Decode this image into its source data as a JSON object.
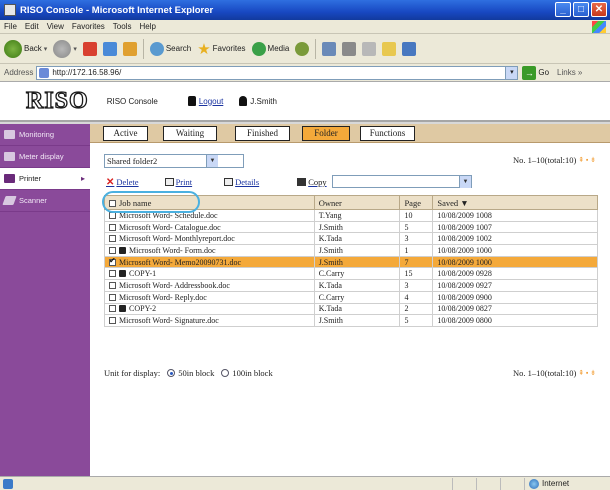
{
  "window": {
    "title": "RISO Console - Microsoft Internet Explorer",
    "controls": [
      "_",
      "□",
      "✕"
    ]
  },
  "menu": [
    "File",
    "Edit",
    "View",
    "Favorites",
    "Tools",
    "Help"
  ],
  "toolbar": {
    "back": "Back",
    "search": "Search",
    "favorites": "Favorites",
    "media": "Media"
  },
  "address": {
    "label": "Address",
    "url": "http://172.16.58.96/",
    "go": "Go",
    "links": "Links »"
  },
  "header": {
    "logo": "RISO",
    "console": "RISO Console",
    "logout": "Logout",
    "user": "J.Smith"
  },
  "sidebar": {
    "items": [
      {
        "label": "Monitoring"
      },
      {
        "label": "Meter display"
      },
      {
        "label": "Printer"
      },
      {
        "label": "Scanner"
      }
    ]
  },
  "tabs": [
    "Active",
    "Waiting",
    "Finished",
    "Folder",
    "Functions"
  ],
  "folder": {
    "selected": "Shared folder2",
    "pager": "No. 1–10(total:10)"
  },
  "actions": {
    "delete": "Delete",
    "print": "Print",
    "details": "Details",
    "copy": "Copy"
  },
  "table": {
    "headers": {
      "name": "Job name",
      "owner": "Owner",
      "page": "Page",
      "saved": "Saved ▼"
    },
    "rows": [
      {
        "name": "Microsoft Word- Schedule.doc",
        "owner": "T.Yang",
        "page": "10",
        "saved": "10/08/2009 1008"
      },
      {
        "name": "Microsoft Word- Catalogue.doc",
        "owner": "J.Smith",
        "page": "5",
        "saved": "10/08/2009 1007"
      },
      {
        "name": "Microsoft Word- Monthlyreport.doc",
        "owner": "K.Tada",
        "page": "3",
        "saved": "10/08/2009 1002"
      },
      {
        "name": "Microsoft Word- Form.doc",
        "owner": "J.Smith",
        "page": "1",
        "saved": "10/08/2009 1000"
      },
      {
        "name": "Microsoft Word- Memo20090731.doc",
        "owner": "J.Smith",
        "page": "7",
        "saved": "10/08/2009 1000"
      },
      {
        "name": "COPY-1",
        "owner": "C.Carry",
        "page": "15",
        "saved": "10/08/2009 0928"
      },
      {
        "name": "Microsoft Word- Addressbook.doc",
        "owner": "K.Tada",
        "page": "3",
        "saved": "10/08/2009 0927"
      },
      {
        "name": "Microsoft Word- Reply.doc",
        "owner": "C.Carry",
        "page": "4",
        "saved": "10/08/2009 0900"
      },
      {
        "name": "COPY-2",
        "owner": "K.Tada",
        "page": "2",
        "saved": "10/08/2009 0827"
      },
      {
        "name": "Microsoft Word- Signature.doc",
        "owner": "J.Smith",
        "page": "5",
        "saved": "10/08/2009 0800"
      }
    ]
  },
  "display": {
    "label": "Unit for display:",
    "opt1": "50in block",
    "opt2": "100in block",
    "pager": "No. 1–10(total:10)"
  },
  "status": {
    "zone": "Internet"
  }
}
